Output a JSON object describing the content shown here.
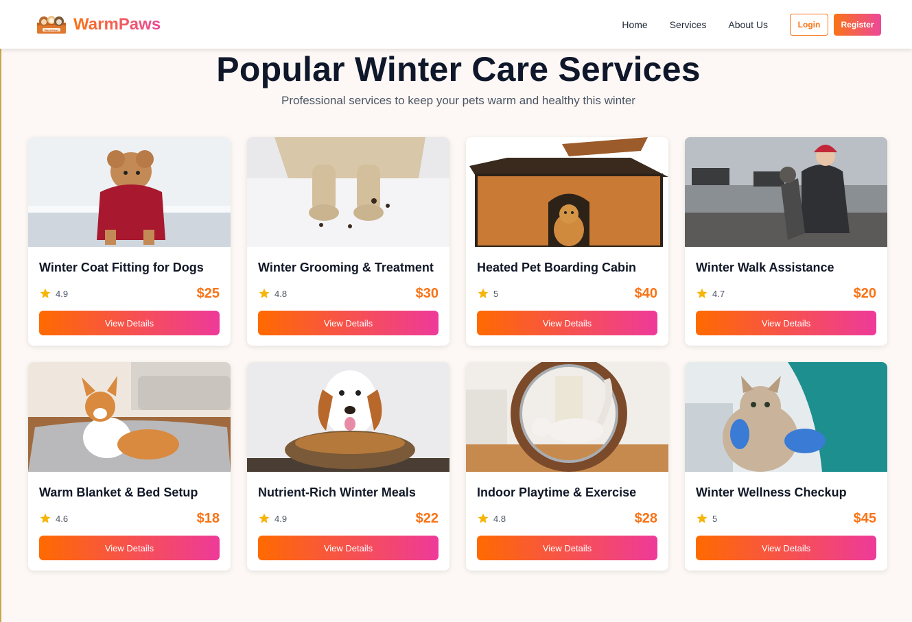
{
  "brand": {
    "name": "WarmPaws",
    "logo_text": "WarmPaws",
    "icon": "paws-logo-icon"
  },
  "nav": {
    "links": [
      "Home",
      "Services",
      "About Us"
    ],
    "login_label": "Login",
    "register_label": "Register"
  },
  "colors": {
    "accent_orange": "#f97316",
    "accent_pink": "#ec4899",
    "star": "#f5b50a"
  },
  "header": {
    "title": "Popular Winter Care Services",
    "subtitle": "Professional services to keep your pets warm and healthy this winter"
  },
  "services": [
    {
      "title": "Winter Coat Fitting for Dogs",
      "rating": "4.9",
      "price": "$25",
      "button": "View Details",
      "image": "dog-in-red-coat"
    },
    {
      "title": "Winter Grooming & Treatment",
      "rating": "4.8",
      "price": "$30",
      "button": "View Details",
      "image": "dog-paws-in-snow"
    },
    {
      "title": "Heated Pet Boarding Cabin",
      "rating": "5",
      "price": "$40",
      "button": "View Details",
      "image": "dog-in-wooden-house"
    },
    {
      "title": "Winter Walk Assistance",
      "rating": "4.7",
      "price": "$20",
      "button": "View Details",
      "image": "woman-with-dog-in-park"
    },
    {
      "title": "Warm Blanket & Bed Setup",
      "rating": "4.6",
      "price": "$18",
      "button": "View Details",
      "image": "corgi-on-blanket"
    },
    {
      "title": "Nutrient-Rich Winter Meals",
      "rating": "4.9",
      "price": "$22",
      "button": "View Details",
      "image": "beagle-with-food-bowl"
    },
    {
      "title": "Indoor Playtime & Exercise",
      "rating": "4.8",
      "price": "$28",
      "button": "View Details",
      "image": "cat-on-exercise-wheel"
    },
    {
      "title": "Winter Wellness Checkup",
      "rating": "5",
      "price": "$45",
      "button": "View Details",
      "image": "cat-vet-checkup"
    }
  ]
}
